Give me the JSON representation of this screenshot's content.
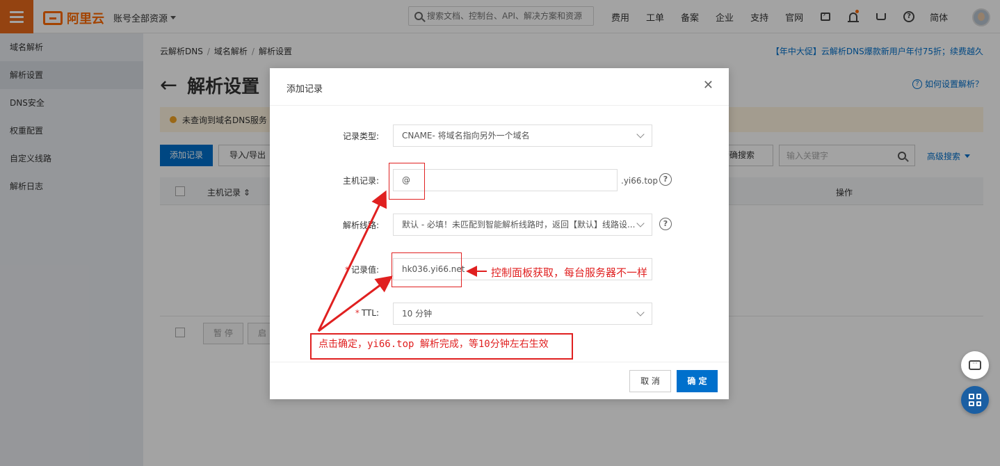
{
  "topbar": {
    "logo_text": "阿里云",
    "account_label": "账号全部资源",
    "search_placeholder": "搜索文档、控制台、API、解决方案和资源",
    "nav": [
      "费用",
      "工单",
      "备案",
      "企业",
      "支持",
      "官网"
    ],
    "lang": "简体",
    "colors": {
      "brand": "#ff6a00",
      "menu_bg": "#e8691c"
    }
  },
  "sidebar": {
    "items": [
      {
        "label": "域名解析",
        "active": false
      },
      {
        "label": "解析设置",
        "active": true
      },
      {
        "label": "DNS安全",
        "active": false
      },
      {
        "label": "权重配置",
        "active": false
      },
      {
        "label": "自定义线路",
        "active": false
      },
      {
        "label": "解析日志",
        "active": false
      }
    ]
  },
  "main": {
    "breadcrumb": [
      "云解析DNS",
      "域名解析",
      "解析设置"
    ],
    "promo": "【年中大促】云解析DNS爆款新用户年付75折；续费越久",
    "title": "解析设置",
    "howto": "如何设置解析？",
    "notice": "未查询到域名DNS服务",
    "toolbar": {
      "add_record": "添加记录",
      "import_export": "导入/导出",
      "precise_search": "精确搜索",
      "keyword_placeholder": "输入关键字",
      "advanced_search": "高级搜索"
    },
    "table": {
      "col_host": "主机记录",
      "col_op": "操作"
    },
    "footer": {
      "pause": "暂 停",
      "enable": "启"
    }
  },
  "modal": {
    "title": "添加记录",
    "fields": {
      "type_label": "记录类型:",
      "type_value": "CNAME- 将域名指向另外一个域名",
      "host_label": "主机记录:",
      "host_value": "@",
      "host_suffix": ".yi66.top",
      "line_label": "解析线路:",
      "line_value": "默认 - 必填！未匹配到智能解析线路时，返回【默认】线路设...",
      "value_label": "记录值:",
      "value_value": "hk036.yi66.net",
      "ttl_label": "TTL:",
      "ttl_value": "10 分钟"
    },
    "cancel": "取 消",
    "ok": "确 定"
  },
  "annotations": {
    "value_note": "控制面板获取，每台服务器不一样",
    "done_note": "点击确定，yi66.top 解析完成，等10分钟左右生效",
    "color": "#e02020"
  }
}
